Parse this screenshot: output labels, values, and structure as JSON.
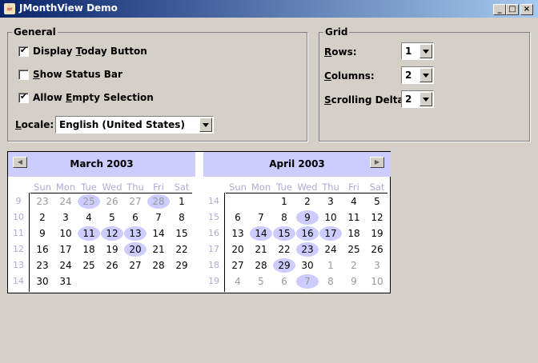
{
  "window": {
    "title": "JMonthView Demo"
  },
  "general": {
    "title": "General",
    "display_today": {
      "label_pre": "Display ",
      "label_u": "T",
      "label_post": "oday Button",
      "checked": true
    },
    "show_status": {
      "label_pre": "",
      "label_u": "S",
      "label_post": "how Status Bar",
      "checked": false
    },
    "allow_empty": {
      "label_pre": "Allow ",
      "label_u": "E",
      "label_post": "mpty Selection",
      "checked": true
    },
    "locale": {
      "label_u": "L",
      "label_post": "ocale:",
      "value": "English (United States)"
    }
  },
  "grid": {
    "title": "Grid",
    "rows": {
      "label_u": "R",
      "label_post": "ows:",
      "value": "1"
    },
    "columns": {
      "label_u": "C",
      "label_post": "olumns:",
      "value": "2"
    },
    "scrolling": {
      "label_u": "S",
      "label_post": "crolling Delta:",
      "value": "2"
    }
  },
  "calendar": {
    "days_of_week": [
      "Sun",
      "Mon",
      "Tue",
      "Wed",
      "Thu",
      "Fri",
      "Sat"
    ],
    "months": [
      {
        "title": "March 2003",
        "weeks": [
          {
            "wk": "9",
            "days": [
              {
                "d": "23",
                "o": true
              },
              {
                "d": "24",
                "o": true
              },
              {
                "d": "25",
                "o": true,
                "s": true
              },
              {
                "d": "26",
                "o": true
              },
              {
                "d": "27",
                "o": true
              },
              {
                "d": "28",
                "o": true,
                "s": true
              },
              {
                "d": "1"
              }
            ]
          },
          {
            "wk": "10",
            "days": [
              {
                "d": "2"
              },
              {
                "d": "3"
              },
              {
                "d": "4"
              },
              {
                "d": "5"
              },
              {
                "d": "6"
              },
              {
                "d": "7"
              },
              {
                "d": "8"
              }
            ]
          },
          {
            "wk": "11",
            "days": [
              {
                "d": "9"
              },
              {
                "d": "10"
              },
              {
                "d": "11",
                "s": true
              },
              {
                "d": "12",
                "s": true
              },
              {
                "d": "13",
                "s": true
              },
              {
                "d": "14"
              },
              {
                "d": "15"
              }
            ]
          },
          {
            "wk": "12",
            "days": [
              {
                "d": "16"
              },
              {
                "d": "17"
              },
              {
                "d": "18"
              },
              {
                "d": "19"
              },
              {
                "d": "20",
                "s": true
              },
              {
                "d": "21"
              },
              {
                "d": "22"
              }
            ]
          },
          {
            "wk": "13",
            "days": [
              {
                "d": "23"
              },
              {
                "d": "24"
              },
              {
                "d": "25"
              },
              {
                "d": "26"
              },
              {
                "d": "27"
              },
              {
                "d": "28"
              },
              {
                "d": "29"
              }
            ]
          },
          {
            "wk": "14",
            "days": [
              {
                "d": "30"
              },
              {
                "d": "31"
              },
              {
                "d": ""
              },
              {
                "d": ""
              },
              {
                "d": ""
              },
              {
                "d": ""
              },
              {
                "d": ""
              }
            ]
          }
        ]
      },
      {
        "title": "April 2003",
        "weeks": [
          {
            "wk": "14",
            "days": [
              {
                "d": ""
              },
              {
                "d": ""
              },
              {
                "d": "1"
              },
              {
                "d": "2"
              },
              {
                "d": "3"
              },
              {
                "d": "4"
              },
              {
                "d": "5"
              }
            ]
          },
          {
            "wk": "15",
            "days": [
              {
                "d": "6"
              },
              {
                "d": "7"
              },
              {
                "d": "8"
              },
              {
                "d": "9",
                "s": true
              },
              {
                "d": "10"
              },
              {
                "d": "11"
              },
              {
                "d": "12"
              }
            ]
          },
          {
            "wk": "16",
            "days": [
              {
                "d": "13"
              },
              {
                "d": "14",
                "s": true
              },
              {
                "d": "15",
                "s": true
              },
              {
                "d": "16",
                "s": true
              },
              {
                "d": "17",
                "s": true
              },
              {
                "d": "18"
              },
              {
                "d": "19"
              }
            ]
          },
          {
            "wk": "17",
            "days": [
              {
                "d": "20"
              },
              {
                "d": "21"
              },
              {
                "d": "22"
              },
              {
                "d": "23",
                "s": true
              },
              {
                "d": "24"
              },
              {
                "d": "25"
              },
              {
                "d": "26"
              }
            ]
          },
          {
            "wk": "18",
            "days": [
              {
                "d": "27"
              },
              {
                "d": "28"
              },
              {
                "d": "29",
                "s": true
              },
              {
                "d": "30"
              },
              {
                "d": "1",
                "o": true
              },
              {
                "d": "2",
                "o": true
              },
              {
                "d": "3",
                "o": true
              }
            ]
          },
          {
            "wk": "19",
            "days": [
              {
                "d": "4",
                "o": true
              },
              {
                "d": "5",
                "o": true
              },
              {
                "d": "6",
                "o": true
              },
              {
                "d": "7",
                "o": true,
                "s": true
              },
              {
                "d": "8",
                "o": true
              },
              {
                "d": "9",
                "o": true
              },
              {
                "d": "10",
                "o": true
              }
            ]
          }
        ]
      }
    ]
  }
}
